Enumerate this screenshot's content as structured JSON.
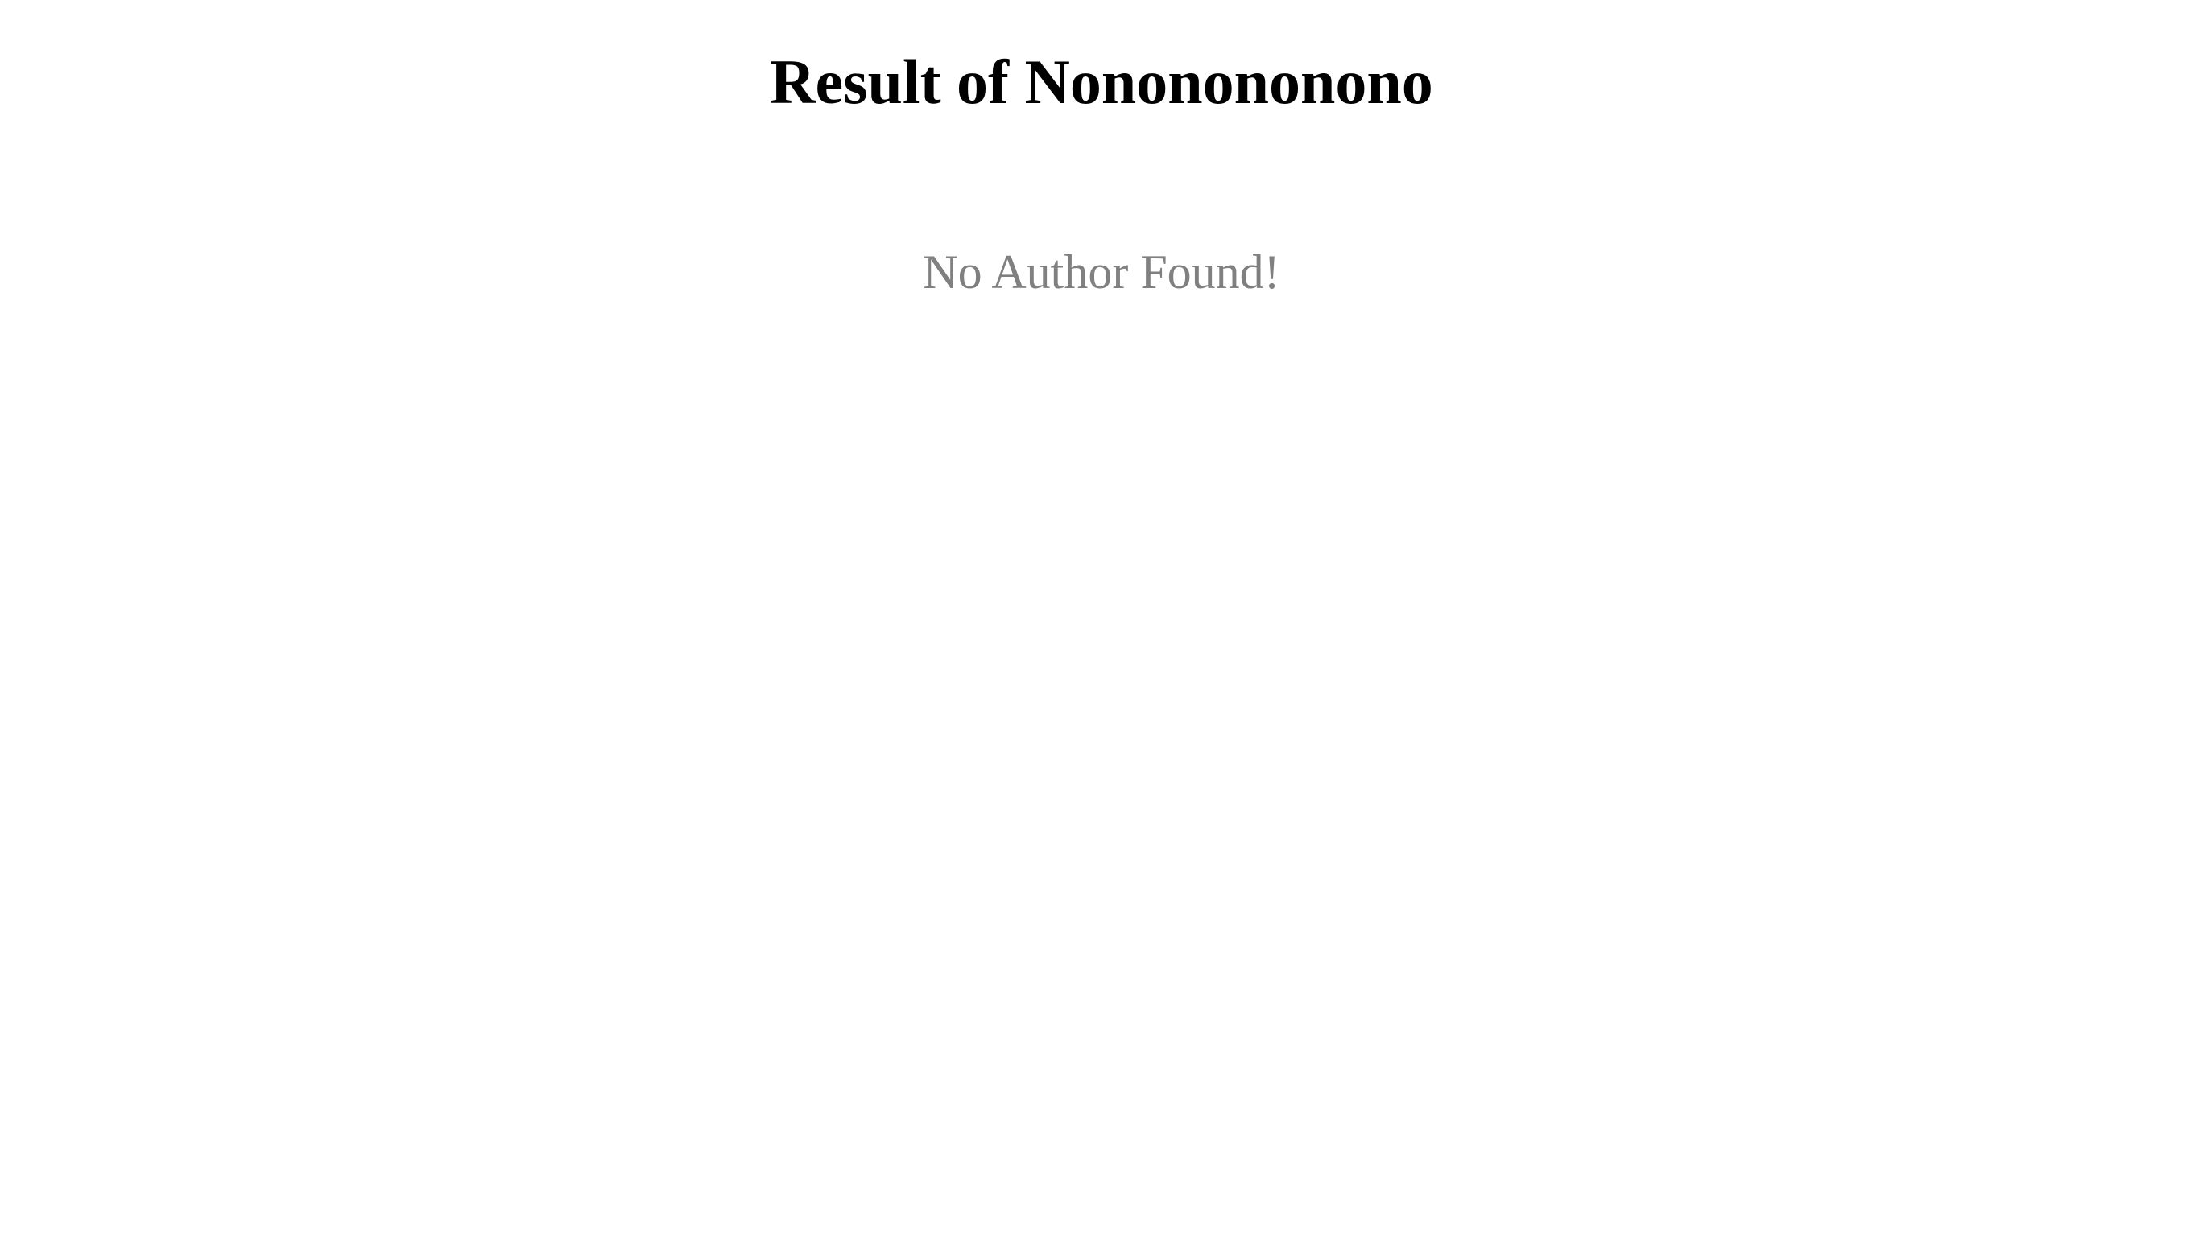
{
  "page": {
    "title": "Result of Nononononono",
    "empty_message": "No Author Found!"
  },
  "colors": {
    "title": "#000000",
    "empty_message": "#808080",
    "background": "#ffffff"
  }
}
